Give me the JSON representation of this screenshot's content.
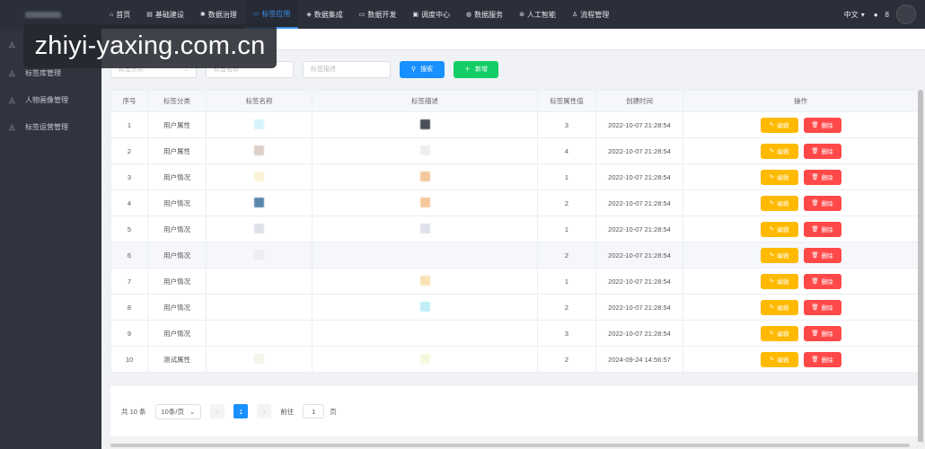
{
  "nav": {
    "items": [
      {
        "label": "首页",
        "icon": "home-icon",
        "glyph": "⌂"
      },
      {
        "label": "基础建设",
        "icon": "document-icon",
        "glyph": "▤"
      },
      {
        "label": "数据治理",
        "icon": "gear-icon",
        "glyph": "✱"
      },
      {
        "label": "标签应用",
        "icon": "tag-icon",
        "glyph": "▭",
        "active": true
      },
      {
        "label": "数据集成",
        "icon": "cube-icon",
        "glyph": "◈"
      },
      {
        "label": "数据开发",
        "icon": "monitor-icon",
        "glyph": "▭"
      },
      {
        "label": "调度中心",
        "icon": "schedule-icon",
        "glyph": "▣"
      },
      {
        "label": "数据服务",
        "icon": "shield-icon",
        "glyph": "◍"
      },
      {
        "label": "人工智能",
        "icon": "ai-icon",
        "glyph": "⊛"
      },
      {
        "label": "流程管理",
        "icon": "flow-icon",
        "glyph": "♙"
      }
    ],
    "language": "中文",
    "user_suffix": "8"
  },
  "sidebar": {
    "items": [
      {
        "label": "",
        "icon": "tag-folder-icon"
      },
      {
        "label": "标签库管理",
        "icon": "tag-folder-icon"
      },
      {
        "label": "人物画像管理",
        "icon": "tag-folder-icon"
      },
      {
        "label": "标签运营管理",
        "icon": "tag-folder-icon"
      }
    ]
  },
  "watermark": "zhiyi-yaxing.com.cn",
  "search": {
    "category_placeholder": "标签分类",
    "name_placeholder": "标签名称",
    "desc_placeholder": "标签描述",
    "search_label": "搜索",
    "add_label": "新增"
  },
  "table": {
    "headers": [
      "序号",
      "标签分类",
      "标签名称",
      "标签描述",
      "标签属性值",
      "创建时间",
      "操作"
    ],
    "edit_label": "编辑",
    "delete_label": "删除",
    "rows": [
      {
        "no": "1",
        "category": "用户属性",
        "attr": "3",
        "time": "2022-10-07 21:28:54"
      },
      {
        "no": "2",
        "category": "用户属性",
        "attr": "4",
        "time": "2022-10-07 21:28:54"
      },
      {
        "no": "3",
        "category": "用户情况",
        "attr": "1",
        "time": "2022-10-07 21:28:54"
      },
      {
        "no": "4",
        "category": "用户情况",
        "attr": "2",
        "time": "2022-10-07 21:28:54"
      },
      {
        "no": "5",
        "category": "用户情况",
        "attr": "1",
        "time": "2022-10-07 21:28:54"
      },
      {
        "no": "6",
        "category": "用户情况",
        "attr": "2",
        "time": "2022-10-07 21:28:54"
      },
      {
        "no": "7",
        "category": "用户情况",
        "attr": "1",
        "time": "2022-10-07 21:28:54"
      },
      {
        "no": "8",
        "category": "用户情况",
        "attr": "2",
        "time": "2022-10-07 21:28:54"
      },
      {
        "no": "9",
        "category": "用户情况",
        "attr": "3",
        "time": "2022-10-07 21:28:54"
      },
      {
        "no": "10",
        "category": "测试属性",
        "attr": "2",
        "time": "2024-09-24 14:56:57"
      }
    ]
  },
  "pager": {
    "total": "共 10 条",
    "page_size": "10条/页",
    "current": "1",
    "goto_prefix": "前往",
    "goto_value": "1",
    "goto_suffix": "页"
  }
}
